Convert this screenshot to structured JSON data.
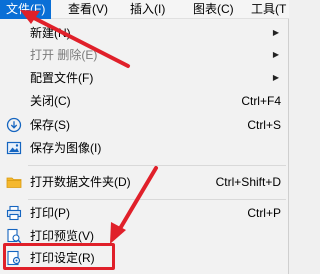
{
  "menubar": {
    "items": [
      {
        "label": "文件(F)"
      },
      {
        "label": "查看(V)"
      },
      {
        "label": "插入(I)"
      },
      {
        "label": "图表(C)"
      },
      {
        "label": "工具(T"
      }
    ]
  },
  "menu": {
    "new": {
      "label": "新建(N)"
    },
    "open": {
      "label": "打开 删除(E)"
    },
    "config": {
      "label": "配置文件(F)"
    },
    "close": {
      "label": "关闭(C)",
      "shortcut": "Ctrl+F4"
    },
    "save": {
      "label": "保存(S)",
      "shortcut": "Ctrl+S",
      "icon": "save-icon"
    },
    "save_image": {
      "label": "保存为图像(I)",
      "icon": "image-icon"
    },
    "open_data_folder": {
      "label": "打开数据文件夹(D)",
      "shortcut": "Ctrl+Shift+D",
      "icon": "folder-icon"
    },
    "print": {
      "label": "打印(P)",
      "shortcut": "Ctrl+P",
      "icon": "printer-icon"
    },
    "print_preview": {
      "label": "打印预览(V)",
      "icon": "print-preview-icon"
    },
    "print_setup": {
      "label": "打印设定(R)",
      "icon": "print-settings-icon"
    }
  },
  "colors": {
    "accent": "#0a6fd6",
    "annotation": "#e0202a",
    "menu_bg": "#f2f2f2"
  }
}
